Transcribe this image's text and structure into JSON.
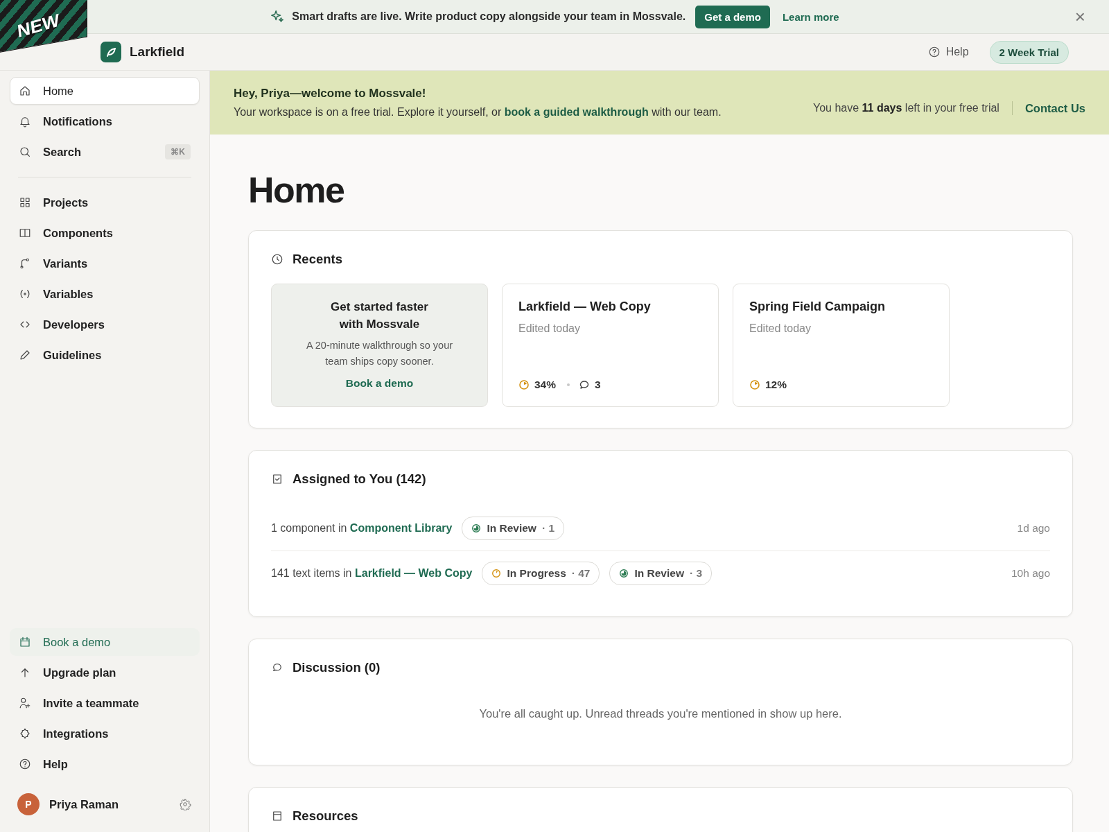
{
  "ribbon": {
    "label": "NEW"
  },
  "announcement": {
    "text": "Smart drafts are live. Write product copy alongside your team in Mossvale.",
    "primary_button": "Get a demo",
    "link": "Learn more",
    "close": "×"
  },
  "topbar": {
    "brand": "Larkfield",
    "help": "Help",
    "trial_badge": "2 Week Trial"
  },
  "sidebar": {
    "items": [
      {
        "label": "Home",
        "selected": true
      },
      {
        "label": "Notifications",
        "selected": false
      },
      {
        "label": "Search",
        "selected": false,
        "shortcut": "⌘K"
      },
      {
        "label": "Projects",
        "selected": false
      },
      {
        "label": "Components",
        "selected": false
      },
      {
        "label": "Variants",
        "selected": false
      },
      {
        "label": "Variables",
        "selected": false
      },
      {
        "label": "Developers",
        "selected": false
      },
      {
        "label": "Guidelines",
        "selected": false
      }
    ],
    "footer_items": [
      {
        "label": "Book a demo",
        "kind": "promo"
      },
      {
        "label": "Upgrade plan",
        "kind": "plain"
      },
      {
        "label": "Invite a teammate",
        "kind": "plain"
      },
      {
        "label": "Integrations",
        "kind": "plain"
      },
      {
        "label": "Help",
        "kind": "plain"
      }
    ],
    "user": {
      "initial": "P",
      "name": "Priya Raman"
    }
  },
  "welcome": {
    "title": "Hey, Priya—welcome to Mossvale!",
    "text_before": "Your workspace is on a free trial. Explore it yourself, or ",
    "link": "book a guided walkthrough",
    "text_after": " with our team.",
    "trial_note": "You have **11 days** left in your free trial",
    "contact": "Contact Us"
  },
  "page_title": "Home",
  "recents": {
    "title": "Recents",
    "promo_card": {
      "title": "Get started faster with Mossvale",
      "body": "A 20-minute walkthrough so your team ships copy sooner.",
      "link": "Book a demo"
    },
    "projects": [
      {
        "name": "Larkfield — Web Copy",
        "edited": "Edited today",
        "progress": "34%",
        "comments": "3"
      },
      {
        "name": "Spring Field Campaign",
        "edited": "Edited today",
        "progress": "12%"
      }
    ]
  },
  "assigned": {
    "title": "Assigned to You (142)",
    "rows": [
      {
        "text": "1 component in",
        "link": "Component Library",
        "time": "1d ago",
        "statuses": [
          {
            "kind": "in_review",
            "label": "In Review",
            "count": "· 1"
          }
        ]
      },
      {
        "text": "141 text items in",
        "link": "Larkfield — Web Copy",
        "time": "10h ago",
        "statuses": [
          {
            "kind": "in_progress",
            "label": "In Progress",
            "count": "· 47"
          },
          {
            "kind": "in_review",
            "label": "In Review",
            "count": "· 3"
          }
        ]
      }
    ]
  },
  "discussion": {
    "title": "Discussion (0)",
    "empty_text": "You're all caught up. Unread threads you're mentioned in show up here."
  },
  "resources": {
    "title": "Resources"
  }
}
